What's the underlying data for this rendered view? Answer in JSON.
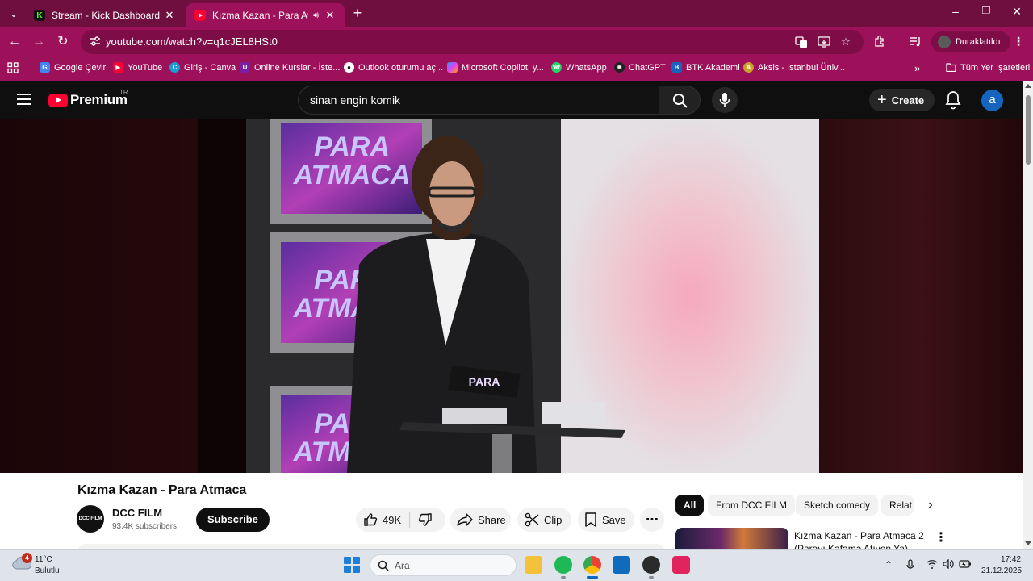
{
  "browser": {
    "tabs": [
      {
        "title": "Stream - Kick Dashboard",
        "icon": "kick-icon"
      },
      {
        "title": "Kızma Kazan - Para Atmaca",
        "icon": "youtube-icon",
        "audio": true
      }
    ],
    "url": "youtube.com/watch?v=q1cJEL8HSt0",
    "profile_label": "Duraklatıldı",
    "accent_color": "#9c1159",
    "bookmarks": [
      {
        "label": "Google Çeviri",
        "icon": "translate-icon"
      },
      {
        "label": "YouTube",
        "icon": "youtube-icon"
      },
      {
        "label": "Giriş - Canva",
        "icon": "canva-icon"
      },
      {
        "label": "Online Kurslar - İste...",
        "icon": "course-icon"
      },
      {
        "label": "Outlook oturumu aç...",
        "icon": "github-icon"
      },
      {
        "label": "Microsoft Copilot, y...",
        "icon": "copilot-icon"
      },
      {
        "label": "WhatsApp",
        "icon": "whatsapp-icon"
      },
      {
        "label": "ChatGPT",
        "icon": "chatgpt-icon"
      },
      {
        "label": "BTK Akademi",
        "icon": "btk-icon"
      },
      {
        "label": "Aksis - İstanbul Üniv...",
        "icon": "aksis-icon"
      }
    ],
    "other_bookmarks": "Tüm Yer İşaretleri"
  },
  "youtube": {
    "logo_text": "Premium",
    "region": "TR",
    "search_query": "sinan engin komik",
    "create_label": "Create",
    "avatar_letter": "a",
    "video": {
      "title": "Kızma Kazan - Para Atmaca",
      "screen_text": "PARA ATMACA",
      "channel": "DCC FILM",
      "channel_logo_text": "DCC FILM",
      "subscribers": "93.4K subscribers",
      "subscribe_label": "Subscribe",
      "likes": "49K",
      "share_label": "Share",
      "clip_label": "Clip",
      "save_label": "Save"
    },
    "chips": [
      "All",
      "From DCC FILM",
      "Sketch comedy",
      "Relat"
    ],
    "recommendation": {
      "title": "Kızma Kazan - Para Atmaca 2 (Parayı Kafama Atıyon Ya)"
    }
  },
  "taskbar": {
    "weather_badge": "4",
    "temperature": "11°C",
    "condition": "Bulutlu",
    "search_placeholder": "Ara",
    "time": "17:42",
    "date": "21.12.2025"
  }
}
